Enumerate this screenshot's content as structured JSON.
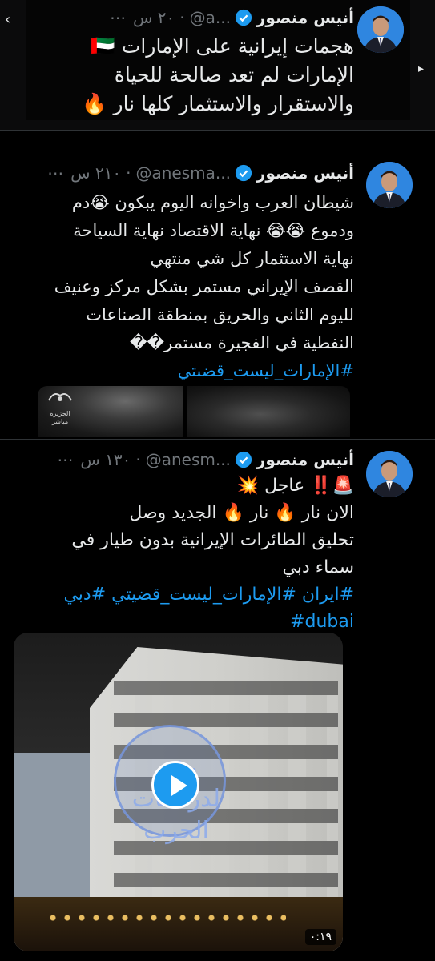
{
  "colors": {
    "background": "#000000",
    "text": "#e7e9ea",
    "muted": "#71767b",
    "link": "#1d9bf0",
    "verified": "#1d9bf0"
  },
  "tweets": [
    {
      "name": "أنيس منصور",
      "handle": "@a...",
      "time": "٢٠ س",
      "more": "⋯",
      "lines": [
        "هجمات إيرانية على الإمارات 🇦🇪",
        "الإمارات لم تعد صالحة للحياة",
        "والاستقرار والاستثمار كلها نار 🔥"
      ]
    },
    {
      "name": "أنيس منصور",
      "handle": "@anesma...",
      "time": "٢١٠ س",
      "more": "⋯",
      "lines": [
        "شيطان العرب واخوانه اليوم  يبكون 😭دم",
        "ودموع 😭😭 نهاية الاقتصاد نهاية السياحة",
        "نهاية الاستثمار كل شي منتهي",
        "القصف الإيراني مستمر بشكل مركز وعنيف",
        "لليوم  الثاني  والحريق بمنطقة الصناعات",
        "النفطية في الفجيرة مستمر��"
      ],
      "hashtag_line": "#الإمارات_ليست_قضىتي",
      "media_logo": "الجزيرة مباشر"
    },
    {
      "name": "أنيس منصور",
      "handle": "@anesm...",
      "time": "١٣٠ س",
      "more": "⋯",
      "lines": [
        "🚨‼️ عاجل 💥",
        "الان نار 🔥 نار 🔥 الجديد وصل",
        "تحليق الطائرات الإيرانية بدون طيار في",
        "سماء دبي"
      ],
      "hashtag_line": "#ايران #الإمارات_ليست_قضيتي #دبي",
      "hashtag_line_2": "#dubai",
      "video_watermark": "رؤى لدراسات الحرب",
      "video_duration": "٠:١٩"
    }
  ],
  "side_nav": {
    "left_arrow": "‹",
    "right_arrow": "▸"
  }
}
